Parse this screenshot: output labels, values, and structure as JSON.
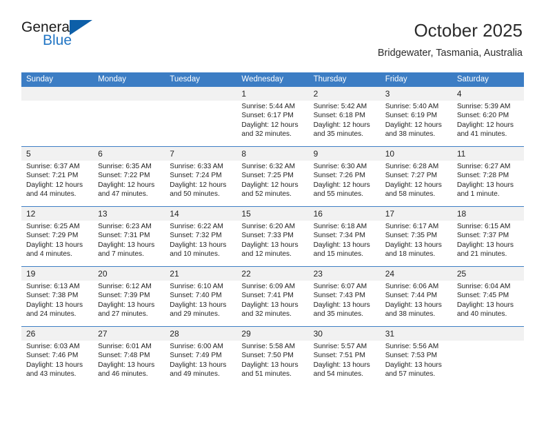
{
  "logo": {
    "word_top": "General",
    "word_bottom": "Blue",
    "triangle_color": "#0d5fa8",
    "blue_color": "#2175c4"
  },
  "header": {
    "title": "October 2025",
    "subtitle": "Bridgewater, Tasmania, Australia"
  },
  "theme": {
    "header_blue": "#3c7dc4",
    "daynum_bg": "#f1f1f1",
    "text": "#222222"
  },
  "weekday_headers": [
    "Sunday",
    "Monday",
    "Tuesday",
    "Wednesday",
    "Thursday",
    "Friday",
    "Saturday"
  ],
  "labels": {
    "sunrise": "Sunrise:",
    "sunset": "Sunset:",
    "daylight": "Daylight:"
  },
  "weeks": [
    [
      {
        "day": "",
        "empty": true
      },
      {
        "day": "",
        "empty": true
      },
      {
        "day": "",
        "empty": true
      },
      {
        "day": "1",
        "sunrise": "Sunrise: 5:44 AM",
        "sunset": "Sunset: 6:17 PM",
        "daylight1": "Daylight: 12 hours",
        "daylight2": "and 32 minutes."
      },
      {
        "day": "2",
        "sunrise": "Sunrise: 5:42 AM",
        "sunset": "Sunset: 6:18 PM",
        "daylight1": "Daylight: 12 hours",
        "daylight2": "and 35 minutes."
      },
      {
        "day": "3",
        "sunrise": "Sunrise: 5:40 AM",
        "sunset": "Sunset: 6:19 PM",
        "daylight1": "Daylight: 12 hours",
        "daylight2": "and 38 minutes."
      },
      {
        "day": "4",
        "sunrise": "Sunrise: 5:39 AM",
        "sunset": "Sunset: 6:20 PM",
        "daylight1": "Daylight: 12 hours",
        "daylight2": "and 41 minutes."
      }
    ],
    [
      {
        "day": "5",
        "sunrise": "Sunrise: 6:37 AM",
        "sunset": "Sunset: 7:21 PM",
        "daylight1": "Daylight: 12 hours",
        "daylight2": "and 44 minutes."
      },
      {
        "day": "6",
        "sunrise": "Sunrise: 6:35 AM",
        "sunset": "Sunset: 7:22 PM",
        "daylight1": "Daylight: 12 hours",
        "daylight2": "and 47 minutes."
      },
      {
        "day": "7",
        "sunrise": "Sunrise: 6:33 AM",
        "sunset": "Sunset: 7:24 PM",
        "daylight1": "Daylight: 12 hours",
        "daylight2": "and 50 minutes."
      },
      {
        "day": "8",
        "sunrise": "Sunrise: 6:32 AM",
        "sunset": "Sunset: 7:25 PM",
        "daylight1": "Daylight: 12 hours",
        "daylight2": "and 52 minutes."
      },
      {
        "day": "9",
        "sunrise": "Sunrise: 6:30 AM",
        "sunset": "Sunset: 7:26 PM",
        "daylight1": "Daylight: 12 hours",
        "daylight2": "and 55 minutes."
      },
      {
        "day": "10",
        "sunrise": "Sunrise: 6:28 AM",
        "sunset": "Sunset: 7:27 PM",
        "daylight1": "Daylight: 12 hours",
        "daylight2": "and 58 minutes."
      },
      {
        "day": "11",
        "sunrise": "Sunrise: 6:27 AM",
        "sunset": "Sunset: 7:28 PM",
        "daylight1": "Daylight: 13 hours",
        "daylight2": "and 1 minute."
      }
    ],
    [
      {
        "day": "12",
        "sunrise": "Sunrise: 6:25 AM",
        "sunset": "Sunset: 7:29 PM",
        "daylight1": "Daylight: 13 hours",
        "daylight2": "and 4 minutes."
      },
      {
        "day": "13",
        "sunrise": "Sunrise: 6:23 AM",
        "sunset": "Sunset: 7:31 PM",
        "daylight1": "Daylight: 13 hours",
        "daylight2": "and 7 minutes."
      },
      {
        "day": "14",
        "sunrise": "Sunrise: 6:22 AM",
        "sunset": "Sunset: 7:32 PM",
        "daylight1": "Daylight: 13 hours",
        "daylight2": "and 10 minutes."
      },
      {
        "day": "15",
        "sunrise": "Sunrise: 6:20 AM",
        "sunset": "Sunset: 7:33 PM",
        "daylight1": "Daylight: 13 hours",
        "daylight2": "and 12 minutes."
      },
      {
        "day": "16",
        "sunrise": "Sunrise: 6:18 AM",
        "sunset": "Sunset: 7:34 PM",
        "daylight1": "Daylight: 13 hours",
        "daylight2": "and 15 minutes."
      },
      {
        "day": "17",
        "sunrise": "Sunrise: 6:17 AM",
        "sunset": "Sunset: 7:35 PM",
        "daylight1": "Daylight: 13 hours",
        "daylight2": "and 18 minutes."
      },
      {
        "day": "18",
        "sunrise": "Sunrise: 6:15 AM",
        "sunset": "Sunset: 7:37 PM",
        "daylight1": "Daylight: 13 hours",
        "daylight2": "and 21 minutes."
      }
    ],
    [
      {
        "day": "19",
        "sunrise": "Sunrise: 6:13 AM",
        "sunset": "Sunset: 7:38 PM",
        "daylight1": "Daylight: 13 hours",
        "daylight2": "and 24 minutes."
      },
      {
        "day": "20",
        "sunrise": "Sunrise: 6:12 AM",
        "sunset": "Sunset: 7:39 PM",
        "daylight1": "Daylight: 13 hours",
        "daylight2": "and 27 minutes."
      },
      {
        "day": "21",
        "sunrise": "Sunrise: 6:10 AM",
        "sunset": "Sunset: 7:40 PM",
        "daylight1": "Daylight: 13 hours",
        "daylight2": "and 29 minutes."
      },
      {
        "day": "22",
        "sunrise": "Sunrise: 6:09 AM",
        "sunset": "Sunset: 7:41 PM",
        "daylight1": "Daylight: 13 hours",
        "daylight2": "and 32 minutes."
      },
      {
        "day": "23",
        "sunrise": "Sunrise: 6:07 AM",
        "sunset": "Sunset: 7:43 PM",
        "daylight1": "Daylight: 13 hours",
        "daylight2": "and 35 minutes."
      },
      {
        "day": "24",
        "sunrise": "Sunrise: 6:06 AM",
        "sunset": "Sunset: 7:44 PM",
        "daylight1": "Daylight: 13 hours",
        "daylight2": "and 38 minutes."
      },
      {
        "day": "25",
        "sunrise": "Sunrise: 6:04 AM",
        "sunset": "Sunset: 7:45 PM",
        "daylight1": "Daylight: 13 hours",
        "daylight2": "and 40 minutes."
      }
    ],
    [
      {
        "day": "26",
        "sunrise": "Sunrise: 6:03 AM",
        "sunset": "Sunset: 7:46 PM",
        "daylight1": "Daylight: 13 hours",
        "daylight2": "and 43 minutes."
      },
      {
        "day": "27",
        "sunrise": "Sunrise: 6:01 AM",
        "sunset": "Sunset: 7:48 PM",
        "daylight1": "Daylight: 13 hours",
        "daylight2": "and 46 minutes."
      },
      {
        "day": "28",
        "sunrise": "Sunrise: 6:00 AM",
        "sunset": "Sunset: 7:49 PM",
        "daylight1": "Daylight: 13 hours",
        "daylight2": "and 49 minutes."
      },
      {
        "day": "29",
        "sunrise": "Sunrise: 5:58 AM",
        "sunset": "Sunset: 7:50 PM",
        "daylight1": "Daylight: 13 hours",
        "daylight2": "and 51 minutes."
      },
      {
        "day": "30",
        "sunrise": "Sunrise: 5:57 AM",
        "sunset": "Sunset: 7:51 PM",
        "daylight1": "Daylight: 13 hours",
        "daylight2": "and 54 minutes."
      },
      {
        "day": "31",
        "sunrise": "Sunrise: 5:56 AM",
        "sunset": "Sunset: 7:53 PM",
        "daylight1": "Daylight: 13 hours",
        "daylight2": "and 57 minutes."
      },
      {
        "day": "",
        "empty": true
      }
    ]
  ]
}
